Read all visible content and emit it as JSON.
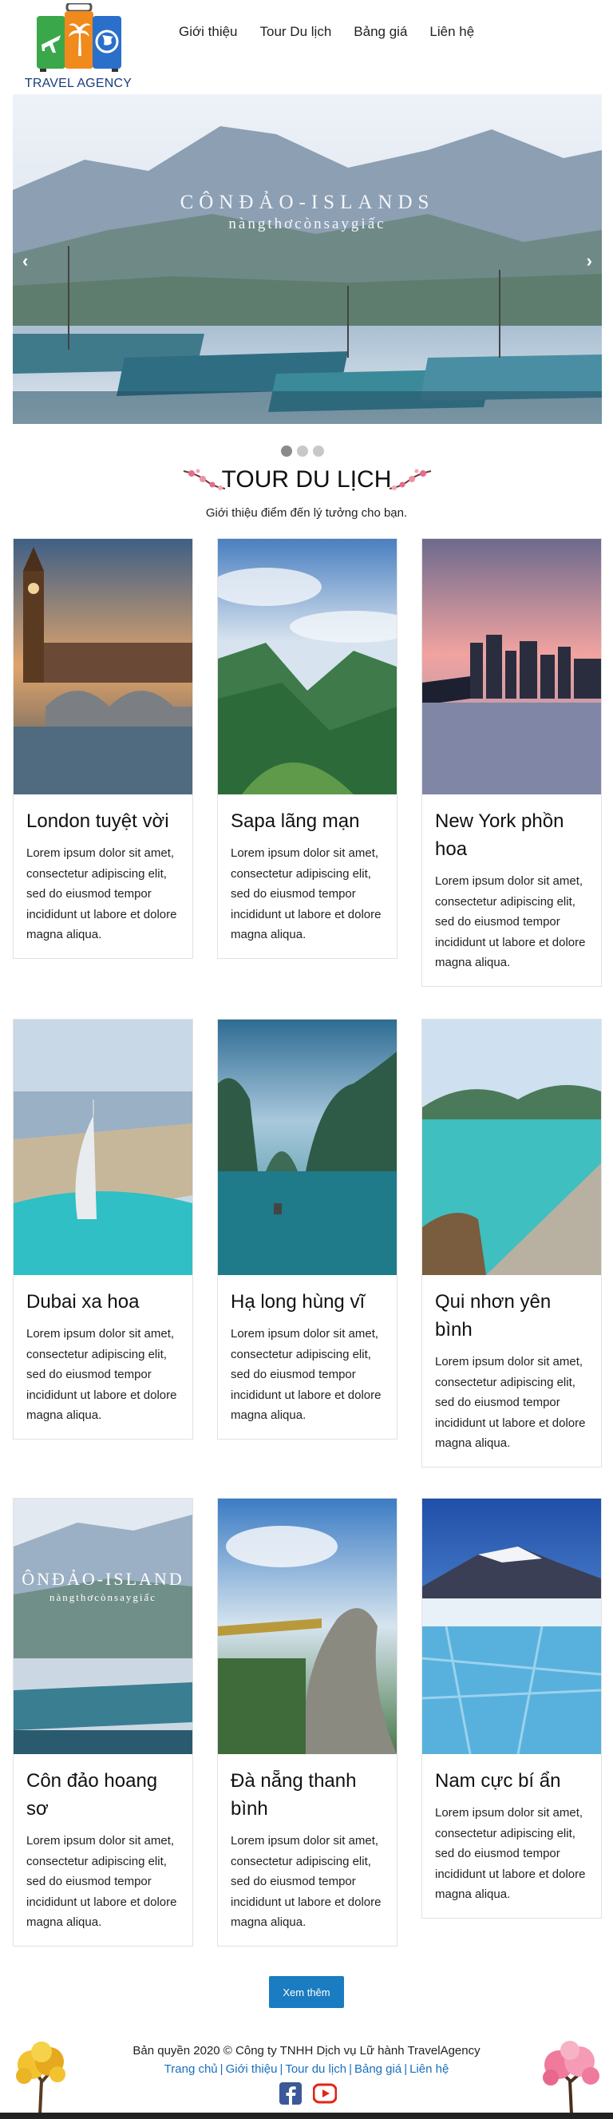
{
  "brand": {
    "name": "TRAVEL AGENCY",
    "colors": {
      "green": "#3aa84a",
      "orange": "#f08a1c",
      "blue": "#2a6fc9",
      "navy": "#1a3e7a"
    }
  },
  "nav": {
    "items": [
      "Giới thiệu",
      "Tour Du lịch",
      "Bảng giá",
      "Liên hệ"
    ]
  },
  "hero": {
    "title": "CÔNĐẢO-ISLANDS",
    "subtitle": "nàngthơcònsaygiấc",
    "prev_icon": "chevron-left-icon",
    "next_icon": "chevron-right-icon",
    "slides": 3,
    "active_slide": 1
  },
  "section": {
    "title": "TOUR DU LỊCH",
    "description": "Giới thiệu điểm đến lý tưởng cho bạn."
  },
  "tours": [
    {
      "title": "London tuyệt vời",
      "text": "Lorem ipsum dolor sit amet, consectetur adipiscing elit, sed do eiusmod tempor incididunt ut labore et dolore magna aliqua."
    },
    {
      "title": "Sapa lãng mạn",
      "text": "Lorem ipsum dolor sit amet, consectetur adipiscing elit, sed do eiusmod tempor incididunt ut labore et dolore magna aliqua."
    },
    {
      "title": "New York phồn hoa",
      "text": "Lorem ipsum dolor sit amet, consectetur adipiscing elit, sed do eiusmod tempor incididunt ut labore et dolore magna aliqua."
    },
    {
      "title": "Dubai xa hoa",
      "text": "Lorem ipsum dolor sit amet, consectetur adipiscing elit, sed do eiusmod tempor incididunt ut labore et dolore magna aliqua."
    },
    {
      "title": "Hạ long hùng vĩ",
      "text": "Lorem ipsum dolor sit amet, consectetur adipiscing elit, sed do eiusmod tempor incididunt ut labore et dolore magna aliqua."
    },
    {
      "title": "Qui nhơn yên bình",
      "text": "Lorem ipsum dolor sit amet, consectetur adipiscing elit, sed do eiusmod tempor incididunt ut labore et dolore magna aliqua."
    },
    {
      "title": "Côn đảo hoang sơ",
      "text": "Lorem ipsum dolor sit amet, consectetur adipiscing elit, sed do eiusmod tempor incididunt ut labore et dolore magna aliqua."
    },
    {
      "title": "Đà nẵng thanh bình",
      "text": "Lorem ipsum dolor sit amet, consectetur adipiscing elit, sed do eiusmod tempor incididunt ut labore et dolore magna aliqua."
    },
    {
      "title": "Nam cực bí ẩn",
      "text": "Lorem ipsum dolor sit amet, consectetur adipiscing elit, sed do eiusmod tempor incididunt ut labore et dolore magna aliqua."
    }
  ],
  "con_dao_thumb": {
    "title": "ÔNĐẢO-ISLAND",
    "subtitle": "nàngthơcònsaygiấc"
  },
  "more_button": "Xem thêm",
  "footer": {
    "copyright": "Bản quyền 2020 © Công ty TNHH Dịch vụ Lữ hành TravelAgency",
    "links": [
      "Trang chủ",
      "Giới thiệu",
      "Tour du lịch",
      "Bảng giá",
      "Liên hệ"
    ],
    "separator": "|",
    "social_icons": [
      "facebook-icon",
      "youtube-icon"
    ],
    "colors": {
      "facebook": "#3b5998",
      "youtube": "#e62117",
      "link": "#1a6fbf"
    }
  }
}
